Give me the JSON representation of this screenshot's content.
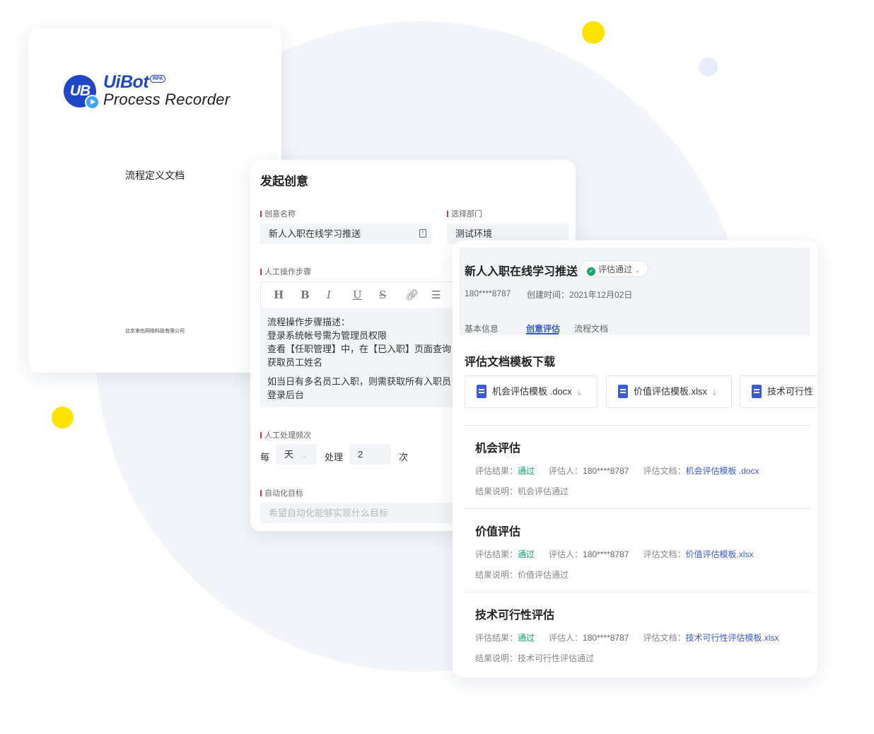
{
  "doc_card": {
    "logo_brand": "UiBot",
    "logo_badge": "UB",
    "logo_rpa": "RPA",
    "logo_subtitle": "Process Recorder",
    "title": "流程定义文档",
    "company": "北京来也网络科技有限公司"
  },
  "form": {
    "title": "发起创意",
    "name_label": "创意名称",
    "name_value": "新人入职在线学习推送",
    "dept_label": "选择部门",
    "dept_value": "测试环境",
    "steps_label": "人工操作步骤",
    "toolbar_icons": [
      "heading-icon",
      "bold-icon",
      "italic-icon",
      "underline-icon",
      "strikethrough-icon",
      "link-icon",
      "list-icon"
    ],
    "steps_lines": [
      "流程操作步骤描述：",
      "登录系统帐号需为管理员权限",
      "查看【任职管理】中，在【已入职】页面查询",
      "获取员工姓名"
    ],
    "steps_lines_2": [
      "如当日有多名员工入职，则需获取所有入职员",
      "登录后台"
    ],
    "freq_label": "人工处理频次",
    "freq_every": "每",
    "freq_unit": "天",
    "freq_process": "处理",
    "freq_count": "2",
    "freq_times": "次",
    "goal_label": "自动化目标",
    "goal_placeholder": "希望自动化能够实现什么目标"
  },
  "detail": {
    "title": "新人入职在线学习推送",
    "status": "评估通过",
    "phone": "180****8787",
    "created_label": "创建时间：",
    "created_value": "2021年12月02日",
    "tabs": [
      "基本信息",
      "创意评估",
      "流程文档"
    ],
    "active_tab": "创意评估",
    "templates_title": "评估文档模板下载",
    "templates": [
      "机会评估模板 .docx",
      "价值评估模板.xlsx",
      "技术可行性"
    ],
    "result_label": "评估结果：",
    "evaluator_label": "评估人：",
    "document_label": "评估文档：",
    "note_label": "结果说明：",
    "evaluations": [
      {
        "title": "机会评估",
        "result": "通过",
        "evaluator": "180****8787",
        "document": "机会评估模板 .docx",
        "note": "机会评估通过"
      },
      {
        "title": "价值评估",
        "result": "通过",
        "evaluator": "180****8787",
        "document": "价值评估模板.xlsx",
        "note": "价值评估通过"
      },
      {
        "title": "技术可行性评估",
        "result": "通过",
        "evaluator": "180****8787",
        "document": "技术可行性评估模板.xlsx",
        "note": "技术可行性评估通过"
      }
    ]
  },
  "colors": {
    "accent": "#3b5bd9",
    "pass": "#1aa36b",
    "required": "#e0303b",
    "dot_yellow": "#fde400"
  }
}
